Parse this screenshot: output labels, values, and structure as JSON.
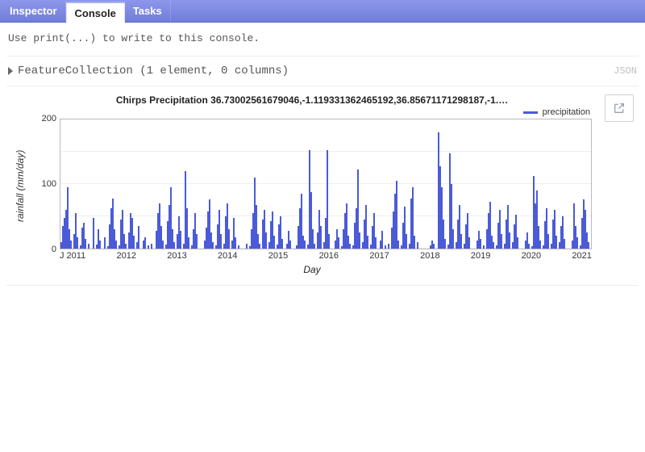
{
  "tabs": {
    "inspector": "Inspector",
    "console": "Console",
    "tasks": "Tasks"
  },
  "active_tab": "console",
  "console": {
    "hint": "Use print(...) to write to this console.",
    "entry_label": "FeatureCollection (1 element, 0 columns)",
    "json_action": "JSON"
  },
  "chart_data": {
    "type": "bar",
    "title": "Chirps Precipitation 36.73002561679046,-1.119331362465192,36.85671171298187,-1.…",
    "xlabel": "Day",
    "ylabel": "rainfall (mm/day)",
    "ylim": [
      0,
      200
    ],
    "y_ticks": [
      0,
      100,
      200
    ],
    "x_ticks": [
      "J 2011",
      "2012",
      "2013",
      "2014",
      "2015",
      "2016",
      "2017",
      "2018",
      "2019",
      "2020",
      "2021"
    ],
    "series": [
      {
        "name": "precipitation",
        "values": [
          10,
          35,
          48,
          60,
          95,
          30,
          12,
          0,
          22,
          55,
          18,
          0,
          5,
          32,
          40,
          15,
          0,
          8,
          0,
          0,
          48,
          0,
          6,
          30,
          12,
          0,
          0,
          18,
          0,
          4,
          38,
          62,
          78,
          30,
          12,
          0,
          5,
          45,
          60,
          22,
          8,
          0,
          25,
          55,
          48,
          20,
          0,
          10,
          35,
          0,
          0,
          12,
          18,
          0,
          5,
          0,
          8,
          0,
          0,
          28,
          55,
          70,
          35,
          12,
          0,
          6,
          42,
          68,
          95,
          30,
          10,
          0,
          22,
          50,
          28,
          0,
          8,
          120,
          62,
          18,
          0,
          5,
          30,
          55,
          22,
          0,
          0,
          0,
          0,
          12,
          32,
          58,
          76,
          25,
          10,
          0,
          5,
          38,
          60,
          22,
          0,
          8,
          50,
          70,
          30,
          0,
          12,
          48,
          18,
          0,
          5,
          0,
          0,
          0,
          0,
          8,
          0,
          4,
          30,
          55,
          110,
          68,
          22,
          8,
          0,
          45,
          60,
          25,
          0,
          10,
          42,
          58,
          20,
          0,
          6,
          38,
          50,
          15,
          0,
          0,
          8,
          28,
          12,
          0,
          0,
          0,
          5,
          35,
          62,
          85,
          20,
          12,
          0,
          6,
          152,
          88,
          30,
          8,
          0,
          25,
          60,
          35,
          0,
          10,
          48,
          152,
          22,
          0,
          0,
          0,
          12,
          30,
          18,
          0,
          4,
          30,
          55,
          70,
          20,
          8,
          0,
          5,
          40,
          62,
          122,
          25,
          0,
          10,
          45,
          68,
          20,
          0,
          6,
          35,
          55,
          18,
          0,
          0,
          12,
          28,
          0,
          5,
          0,
          8,
          0,
          32,
          58,
          85,
          105,
          12,
          0,
          5,
          40,
          65,
          22,
          0,
          8,
          78,
          95,
          20,
          0,
          10,
          0,
          0,
          0,
          0,
          0,
          0,
          0,
          5,
          12,
          8,
          0,
          0,
          180,
          128,
          95,
          45,
          15,
          0,
          6,
          148,
          100,
          30,
          0,
          10,
          45,
          68,
          22,
          0,
          8,
          38,
          55,
          18,
          0,
          0,
          0,
          0,
          12,
          28,
          15,
          0,
          5,
          0,
          30,
          55,
          72,
          20,
          10,
          0,
          5,
          40,
          60,
          22,
          0,
          8,
          45,
          68,
          25,
          0,
          10,
          38,
          52,
          18,
          0,
          0,
          0,
          0,
          12,
          25,
          8,
          0,
          4,
          112,
          70,
          90,
          35,
          12,
          0,
          5,
          42,
          62,
          22,
          0,
          8,
          45,
          60,
          20,
          0,
          10,
          35,
          50,
          15,
          0,
          0,
          0,
          0,
          12,
          70,
          35,
          18,
          0,
          5,
          48,
          76,
          60,
          25,
          10,
          0,
          5,
          38,
          55,
          20,
          0,
          8,
          42,
          58,
          18,
          0,
          10
        ]
      }
    ],
    "legend_position": "top-right",
    "color": "#4b5bd7"
  },
  "icons": {
    "expand": "external-link-icon",
    "triangle": "expand-triangle-icon"
  }
}
